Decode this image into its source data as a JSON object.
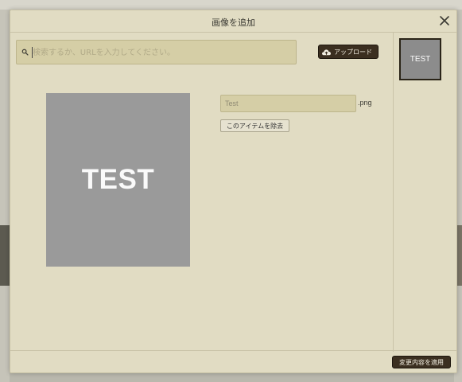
{
  "modal": {
    "title": "画像を追加",
    "search_placeholder": "検索するか、URLを入力してください。",
    "upload_label": "アップロード",
    "preview_text": "TEST",
    "filename_value": "Test",
    "extension": ".png",
    "remove_label": "このアイテムを除去",
    "thumbnail_text": "TEST",
    "apply_label": "変更内容を適用"
  },
  "icons": {
    "close": "close-icon",
    "search": "search-icon",
    "upload": "cloud-upload-icon"
  },
  "colors": {
    "modal_bg": "#e1dcc3",
    "input_bg": "#d5cea6",
    "dark_button": "#3b2f20",
    "preview_gray": "#9a9a9a"
  }
}
